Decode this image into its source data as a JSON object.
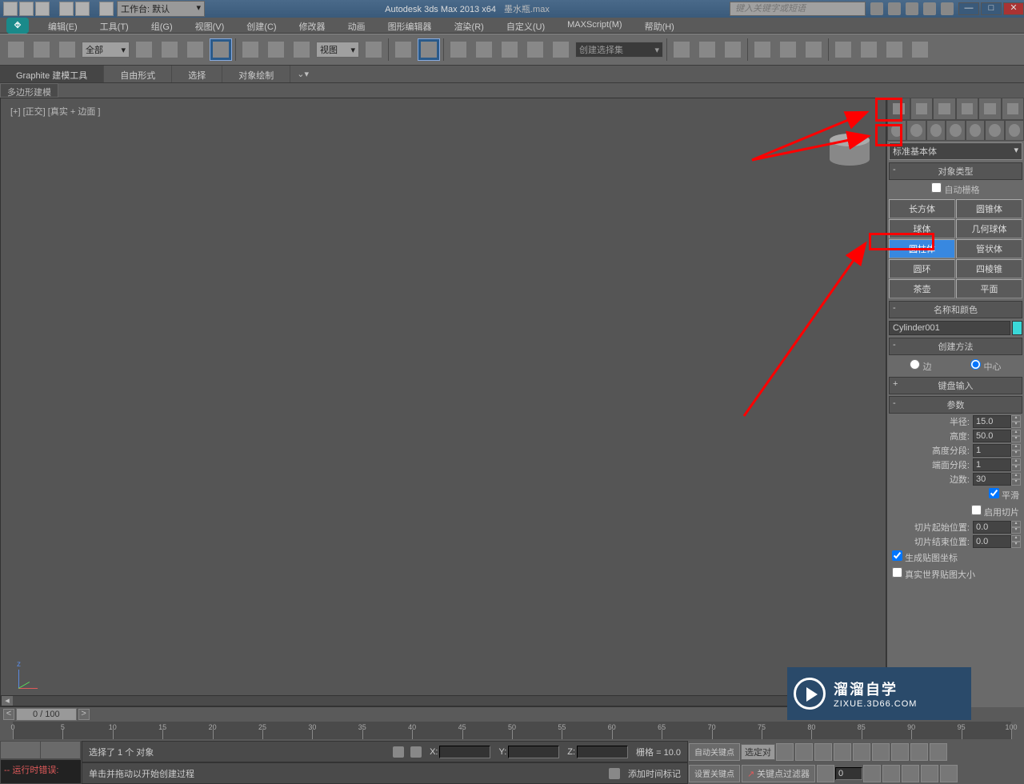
{
  "titlebar": {
    "workspace": "工作台: 默认",
    "app": "Autodesk 3ds Max  2013 x64",
    "file": "墨水瓶.max",
    "search_placeholder": "键入关键字或短语"
  },
  "menu": [
    "编辑(E)",
    "工具(T)",
    "组(G)",
    "视图(V)",
    "创建(C)",
    "修改器",
    "动画",
    "图形编辑器",
    "渲染(R)",
    "自定义(U)",
    "MAXScript(M)",
    "帮助(H)"
  ],
  "toolbar": {
    "filter_dd": "全部",
    "view_dd": "视图",
    "named_set_dd": "创建选择集"
  },
  "ribbon": {
    "tabs": [
      "Graphite 建模工具",
      "自由形式",
      "选择",
      "对象绘制"
    ],
    "sub": "多边形建模"
  },
  "viewport": {
    "label": "[+] [正交] [真实 + 边面 ]"
  },
  "cmd_panel": {
    "category_dd": "标准基本体",
    "rollouts": {
      "obj_type": "对象类型",
      "auto_grid": "自动栅格",
      "name_color": "名称和颜色",
      "create_method": "创建方法",
      "keyboard": "键盘输入",
      "params": "参数"
    },
    "object_buttons": [
      [
        "长方体",
        "圆锥体"
      ],
      [
        "球体",
        "几何球体"
      ],
      [
        "圆柱体",
        "管状体"
      ],
      [
        "圆环",
        "四棱锥"
      ],
      [
        "茶壶",
        "平面"
      ]
    ],
    "selected_button": "圆柱体",
    "object_name": "Cylinder001",
    "create_method_opts": {
      "edge": "边",
      "center": "中心"
    },
    "params": {
      "radius_label": "半径:",
      "radius": "15.0",
      "height_label": "高度:",
      "height": "50.0",
      "hseg_label": "高度分段:",
      "hseg": "1",
      "cseg_label": "端面分段:",
      "cseg": "1",
      "sides_label": "边数:",
      "sides": "30",
      "smooth": "平滑",
      "slice_on": "启用切片",
      "slice_from_label": "切片起始位置:",
      "slice_from": "0.0",
      "slice_to_label": "切片结束位置:",
      "slice_to": "0.0",
      "gen_uv": "生成贴图坐标",
      "real_world": "真实世界贴图大小"
    }
  },
  "timeline": {
    "slider": "0 / 100",
    "ticks": [
      0,
      5,
      10,
      15,
      20,
      25,
      30,
      35,
      40,
      45,
      50,
      55,
      60,
      65,
      70,
      75,
      80,
      85,
      90,
      95,
      100
    ]
  },
  "status": {
    "err": "运行时错误:",
    "sel": "选择了 1 个 对象",
    "prompt": "单击并拖动以开始创建过程",
    "grid": "栅格 = 10.0",
    "add_marker": "添加时间标记",
    "auto_key": "自动关键点",
    "set_key": "设置关键点",
    "selected_dd": "选定对",
    "key_filter": "关键点过滤器"
  },
  "watermark": {
    "big": "溜溜自学",
    "small": "ZIXUE.3D66.COM"
  }
}
